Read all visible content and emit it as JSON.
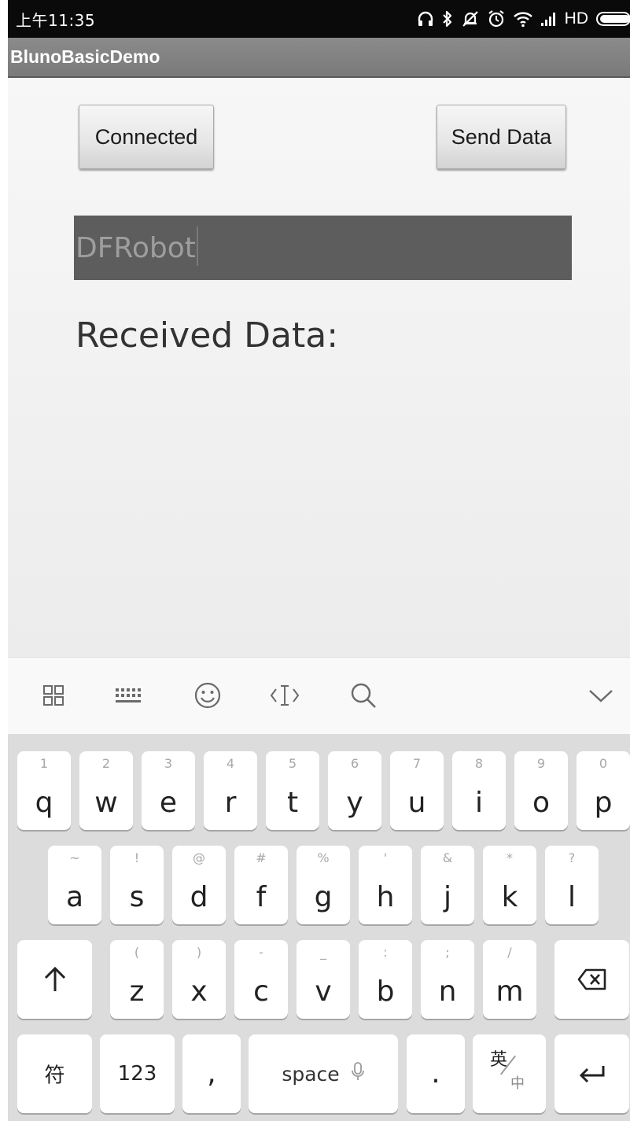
{
  "status_bar": {
    "time": "上午11:35",
    "network_label": "HD",
    "icons": [
      "headphones-icon",
      "bluetooth-icon",
      "silent-icon",
      "alarm-icon",
      "wifi-icon",
      "signal-icon",
      "battery-icon"
    ]
  },
  "app": {
    "title": "BlunoBasicDemo"
  },
  "main": {
    "connect_label": "Connected",
    "send_label": "Send Data",
    "input_value": "DFRobot",
    "received_label": "Received Data:"
  },
  "keyboard_toolbar": {
    "icons": [
      "apps-grid-icon",
      "keyboard-layout-icon",
      "emoji-icon",
      "cursor-edit-icon",
      "search-icon",
      "collapse-chevron-icon"
    ]
  },
  "keyboard": {
    "row1": [
      {
        "key": "q",
        "hint": "1"
      },
      {
        "key": "w",
        "hint": "2"
      },
      {
        "key": "e",
        "hint": "3"
      },
      {
        "key": "r",
        "hint": "4"
      },
      {
        "key": "t",
        "hint": "5"
      },
      {
        "key": "y",
        "hint": "6"
      },
      {
        "key": "u",
        "hint": "7"
      },
      {
        "key": "i",
        "hint": "8"
      },
      {
        "key": "o",
        "hint": "9"
      },
      {
        "key": "p",
        "hint": "0"
      }
    ],
    "row2": [
      {
        "key": "a",
        "hint": "~"
      },
      {
        "key": "s",
        "hint": "!"
      },
      {
        "key": "d",
        "hint": "@"
      },
      {
        "key": "f",
        "hint": "#"
      },
      {
        "key": "g",
        "hint": "%"
      },
      {
        "key": "h",
        "hint": "'"
      },
      {
        "key": "j",
        "hint": "&"
      },
      {
        "key": "k",
        "hint": "*"
      },
      {
        "key": "l",
        "hint": "?"
      }
    ],
    "row3": [
      {
        "key": "z",
        "hint": "("
      },
      {
        "key": "x",
        "hint": ")"
      },
      {
        "key": "c",
        "hint": "-"
      },
      {
        "key": "v",
        "hint": "_"
      },
      {
        "key": "b",
        "hint": ":"
      },
      {
        "key": "n",
        "hint": ";"
      },
      {
        "key": "m",
        "hint": "/"
      }
    ],
    "symbols_label": "符",
    "numbers_label": "123",
    "comma_label": ",",
    "space_label": "space",
    "period_label": ".",
    "lang_primary": "英",
    "lang_secondary": "中"
  },
  "colors": {
    "status_bar_bg": "#0a0a0a",
    "action_bar_bg": "#808080",
    "input_bg": "#5d5d5d",
    "keyboard_bg": "#dcdcdc"
  }
}
